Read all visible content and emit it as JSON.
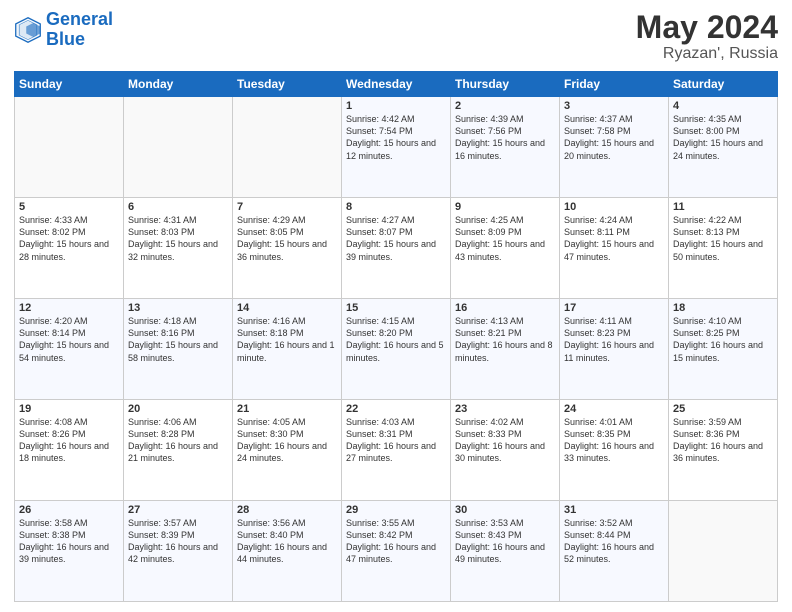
{
  "header": {
    "logo_line1": "General",
    "logo_line2": "Blue",
    "month": "May 2024",
    "location": "Ryazan', Russia"
  },
  "weekdays": [
    "Sunday",
    "Monday",
    "Tuesday",
    "Wednesday",
    "Thursday",
    "Friday",
    "Saturday"
  ],
  "weeks": [
    [
      {
        "day": "",
        "sunrise": "",
        "sunset": "",
        "daylight": ""
      },
      {
        "day": "",
        "sunrise": "",
        "sunset": "",
        "daylight": ""
      },
      {
        "day": "",
        "sunrise": "",
        "sunset": "",
        "daylight": ""
      },
      {
        "day": "1",
        "sunrise": "Sunrise: 4:42 AM",
        "sunset": "Sunset: 7:54 PM",
        "daylight": "Daylight: 15 hours and 12 minutes."
      },
      {
        "day": "2",
        "sunrise": "Sunrise: 4:39 AM",
        "sunset": "Sunset: 7:56 PM",
        "daylight": "Daylight: 15 hours and 16 minutes."
      },
      {
        "day": "3",
        "sunrise": "Sunrise: 4:37 AM",
        "sunset": "Sunset: 7:58 PM",
        "daylight": "Daylight: 15 hours and 20 minutes."
      },
      {
        "day": "4",
        "sunrise": "Sunrise: 4:35 AM",
        "sunset": "Sunset: 8:00 PM",
        "daylight": "Daylight: 15 hours and 24 minutes."
      }
    ],
    [
      {
        "day": "5",
        "sunrise": "Sunrise: 4:33 AM",
        "sunset": "Sunset: 8:02 PM",
        "daylight": "Daylight: 15 hours and 28 minutes."
      },
      {
        "day": "6",
        "sunrise": "Sunrise: 4:31 AM",
        "sunset": "Sunset: 8:03 PM",
        "daylight": "Daylight: 15 hours and 32 minutes."
      },
      {
        "day": "7",
        "sunrise": "Sunrise: 4:29 AM",
        "sunset": "Sunset: 8:05 PM",
        "daylight": "Daylight: 15 hours and 36 minutes."
      },
      {
        "day": "8",
        "sunrise": "Sunrise: 4:27 AM",
        "sunset": "Sunset: 8:07 PM",
        "daylight": "Daylight: 15 hours and 39 minutes."
      },
      {
        "day": "9",
        "sunrise": "Sunrise: 4:25 AM",
        "sunset": "Sunset: 8:09 PM",
        "daylight": "Daylight: 15 hours and 43 minutes."
      },
      {
        "day": "10",
        "sunrise": "Sunrise: 4:24 AM",
        "sunset": "Sunset: 8:11 PM",
        "daylight": "Daylight: 15 hours and 47 minutes."
      },
      {
        "day": "11",
        "sunrise": "Sunrise: 4:22 AM",
        "sunset": "Sunset: 8:13 PM",
        "daylight": "Daylight: 15 hours and 50 minutes."
      }
    ],
    [
      {
        "day": "12",
        "sunrise": "Sunrise: 4:20 AM",
        "sunset": "Sunset: 8:14 PM",
        "daylight": "Daylight: 15 hours and 54 minutes."
      },
      {
        "day": "13",
        "sunrise": "Sunrise: 4:18 AM",
        "sunset": "Sunset: 8:16 PM",
        "daylight": "Daylight: 15 hours and 58 minutes."
      },
      {
        "day": "14",
        "sunrise": "Sunrise: 4:16 AM",
        "sunset": "Sunset: 8:18 PM",
        "daylight": "Daylight: 16 hours and 1 minute."
      },
      {
        "day": "15",
        "sunrise": "Sunrise: 4:15 AM",
        "sunset": "Sunset: 8:20 PM",
        "daylight": "Daylight: 16 hours and 5 minutes."
      },
      {
        "day": "16",
        "sunrise": "Sunrise: 4:13 AM",
        "sunset": "Sunset: 8:21 PM",
        "daylight": "Daylight: 16 hours and 8 minutes."
      },
      {
        "day": "17",
        "sunrise": "Sunrise: 4:11 AM",
        "sunset": "Sunset: 8:23 PM",
        "daylight": "Daylight: 16 hours and 11 minutes."
      },
      {
        "day": "18",
        "sunrise": "Sunrise: 4:10 AM",
        "sunset": "Sunset: 8:25 PM",
        "daylight": "Daylight: 16 hours and 15 minutes."
      }
    ],
    [
      {
        "day": "19",
        "sunrise": "Sunrise: 4:08 AM",
        "sunset": "Sunset: 8:26 PM",
        "daylight": "Daylight: 16 hours and 18 minutes."
      },
      {
        "day": "20",
        "sunrise": "Sunrise: 4:06 AM",
        "sunset": "Sunset: 8:28 PM",
        "daylight": "Daylight: 16 hours and 21 minutes."
      },
      {
        "day": "21",
        "sunrise": "Sunrise: 4:05 AM",
        "sunset": "Sunset: 8:30 PM",
        "daylight": "Daylight: 16 hours and 24 minutes."
      },
      {
        "day": "22",
        "sunrise": "Sunrise: 4:03 AM",
        "sunset": "Sunset: 8:31 PM",
        "daylight": "Daylight: 16 hours and 27 minutes."
      },
      {
        "day": "23",
        "sunrise": "Sunrise: 4:02 AM",
        "sunset": "Sunset: 8:33 PM",
        "daylight": "Daylight: 16 hours and 30 minutes."
      },
      {
        "day": "24",
        "sunrise": "Sunrise: 4:01 AM",
        "sunset": "Sunset: 8:35 PM",
        "daylight": "Daylight: 16 hours and 33 minutes."
      },
      {
        "day": "25",
        "sunrise": "Sunrise: 3:59 AM",
        "sunset": "Sunset: 8:36 PM",
        "daylight": "Daylight: 16 hours and 36 minutes."
      }
    ],
    [
      {
        "day": "26",
        "sunrise": "Sunrise: 3:58 AM",
        "sunset": "Sunset: 8:38 PM",
        "daylight": "Daylight: 16 hours and 39 minutes."
      },
      {
        "day": "27",
        "sunrise": "Sunrise: 3:57 AM",
        "sunset": "Sunset: 8:39 PM",
        "daylight": "Daylight: 16 hours and 42 minutes."
      },
      {
        "day": "28",
        "sunrise": "Sunrise: 3:56 AM",
        "sunset": "Sunset: 8:40 PM",
        "daylight": "Daylight: 16 hours and 44 minutes."
      },
      {
        "day": "29",
        "sunrise": "Sunrise: 3:55 AM",
        "sunset": "Sunset: 8:42 PM",
        "daylight": "Daylight: 16 hours and 47 minutes."
      },
      {
        "day": "30",
        "sunrise": "Sunrise: 3:53 AM",
        "sunset": "Sunset: 8:43 PM",
        "daylight": "Daylight: 16 hours and 49 minutes."
      },
      {
        "day": "31",
        "sunrise": "Sunrise: 3:52 AM",
        "sunset": "Sunset: 8:44 PM",
        "daylight": "Daylight: 16 hours and 52 minutes."
      },
      {
        "day": "",
        "sunrise": "",
        "sunset": "",
        "daylight": ""
      }
    ]
  ]
}
